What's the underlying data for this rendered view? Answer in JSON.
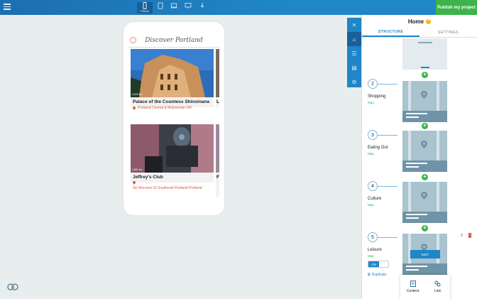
{
  "topbar": {
    "devices": [
      {
        "name": "phone",
        "label": "Phone",
        "active": true
      },
      {
        "name": "tablet-portrait",
        "active": false
      },
      {
        "name": "laptop",
        "active": false
      },
      {
        "name": "desktop",
        "active": false
      },
      {
        "name": "download",
        "active": false
      }
    ],
    "publish_label": "Publish my project"
  },
  "phone": {
    "title": "Discover Portland",
    "cards": [
      {
        "title": "Palace of the Countess Shinsinana",
        "address": "Portland Central & Multnomah OR",
        "distance": "5,923 km"
      },
      {
        "title": "Jeffrey's Club",
        "address": "SE Morrison St Southeast Portland Portland",
        "distance": "4,987 km"
      }
    ],
    "peek_letters": [
      "L",
      "F"
    ]
  },
  "panel": {
    "title": "Home",
    "tabs": [
      "STRUCTURE",
      "SETTINGS"
    ],
    "sections": [
      {
        "number": "2",
        "title": "Shopping",
        "type": "Map"
      },
      {
        "number": "3",
        "title": "Eating Out",
        "type": "Map"
      },
      {
        "number": "4",
        "title": "Culture",
        "type": "Map"
      },
      {
        "number": "5",
        "title": "Leisure",
        "type": "Map"
      }
    ],
    "toggle_label": "ON",
    "duplicate_label": "Duplicate",
    "edit_label": "EDIT",
    "popup": {
      "content_label": "Content",
      "link_label": "Link"
    }
  },
  "colors": {
    "accent": "#1f86c7",
    "publish": "#3cb44a",
    "address": "#d05a4a"
  }
}
